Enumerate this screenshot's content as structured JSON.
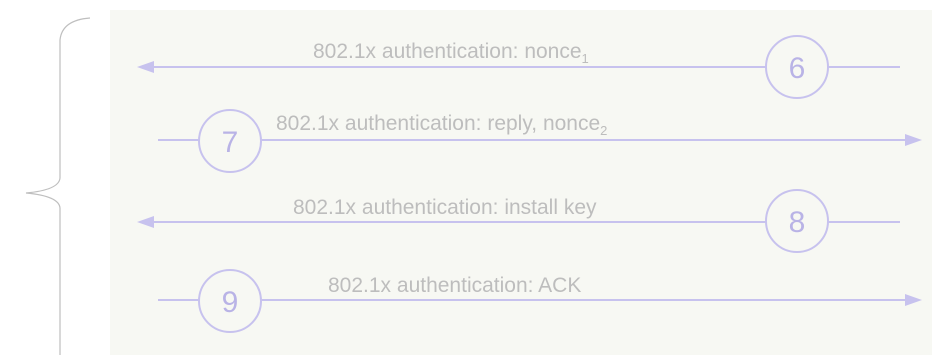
{
  "colors": {
    "panel": "#f7f8f3",
    "arrow": "#c7c2ee",
    "circle": "#c7c2ee",
    "text": "#bdbdbd",
    "number": "#b9b3e6",
    "brace": "#bfbfbf"
  },
  "messages": [
    {
      "direction": "left",
      "step": "6",
      "label": "802.1x authentication: nonce",
      "subscript": "1"
    },
    {
      "direction": "right",
      "step": "7",
      "label": "802.1x authentication: reply, nonce",
      "subscript": "2"
    },
    {
      "direction": "left",
      "step": "8",
      "label": "802.1x authentication: install key",
      "subscript": ""
    },
    {
      "direction": "right",
      "step": "9",
      "label": "802.1x authentication: ACK",
      "subscript": ""
    }
  ]
}
